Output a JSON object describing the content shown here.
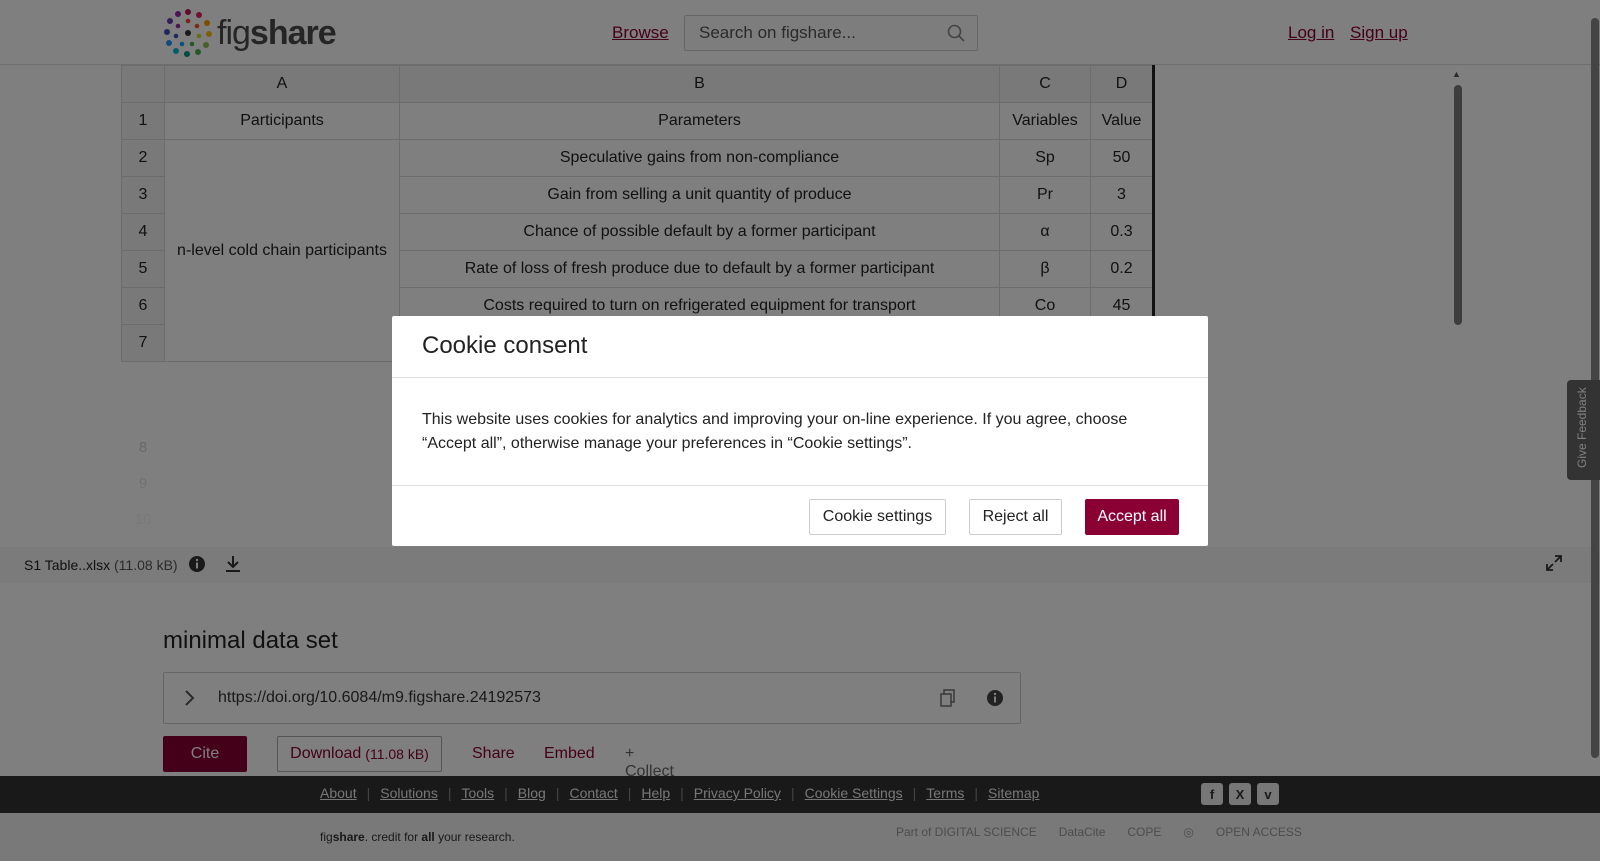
{
  "header": {
    "logo_text_light": "fig",
    "logo_text_bold": "share",
    "browse_label": "Browse",
    "search_placeholder": "Search on figshare...",
    "login_label": "Log in",
    "signup_label": "Sign up"
  },
  "spreadsheet": {
    "column_headers": [
      "A",
      "B",
      "C",
      "D"
    ],
    "row_numbers": [
      "1",
      "2",
      "3",
      "4",
      "5",
      "6",
      "7"
    ],
    "faded_row_numbers": [
      "8",
      "9",
      "10"
    ],
    "merged_participants_label": "n-level cold chain participants",
    "rows": [
      {
        "a": "Participants",
        "b": "Parameters",
        "c": "Variables",
        "d": "Value"
      },
      {
        "b": "Speculative gains from non-compliance",
        "c": "Sp",
        "d": "50"
      },
      {
        "b": "Gain from selling a unit quantity of produce",
        "c": "Pr",
        "d": "3"
      },
      {
        "b": "Chance of possible default by a former participant",
        "c": "α",
        "d": "0.3"
      },
      {
        "b": "Rate of loss of fresh produce due to default by a former participant",
        "c": "β",
        "d": "0.2"
      },
      {
        "b": "Costs required to turn on refrigerated equipment for transport",
        "c": "Co",
        "d": "45"
      },
      {
        "b": "",
        "c": "",
        "d": ""
      }
    ]
  },
  "file_bar": {
    "file_name": "S1 Table..xlsx",
    "file_size": "(11.08 kB)"
  },
  "item": {
    "title": "minimal data set",
    "doi": "https://doi.org/10.6084/m9.figshare.24192573",
    "cite_label": "Cite",
    "download_label": "Download",
    "download_size": "(11.08 kB)",
    "share_label": "Share",
    "embed_label": "Embed",
    "collect_label": "+ Collect"
  },
  "footer": {
    "links": [
      "About",
      "Solutions",
      "Tools",
      "Blog",
      "Contact",
      "Help",
      "Privacy Policy",
      "Cookie Settings",
      "Terms",
      "Sitemap"
    ],
    "tagline_fig": "fig",
    "tagline_share": "share",
    "tagline_mid": ". credit for ",
    "tagline_all": "all",
    "tagline_end": " your research.",
    "partner_digital_science": "Part of DIGITAL SCIENCE",
    "partner_datacite": "DataCite",
    "partner_cope": "COPE",
    "partner_open_access": "OPEN ACCESS"
  },
  "feedback_label": "Give Feedback",
  "cookie_modal": {
    "title": "Cookie consent",
    "body": "This website uses cookies for analytics and improving your on-line experience. If you agree, choose “Accept all”, otherwise manage your preferences in “Cookie settings”.",
    "settings_label": "Cookie settings",
    "reject_label": "Reject all",
    "accept_label": "Accept all"
  },
  "colors": {
    "brand": "#8b0033",
    "overlay": "rgba(0,0,0,0.5)",
    "footer_dark": "#333333"
  }
}
